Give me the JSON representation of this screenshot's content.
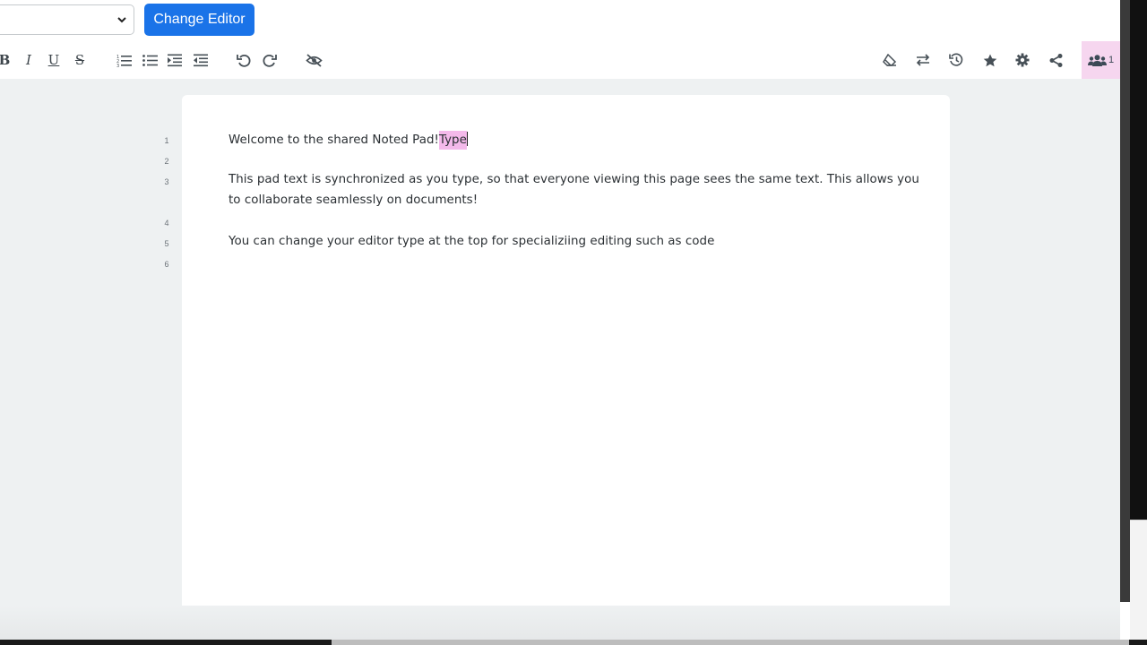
{
  "topbar": {
    "editor_select_value": "",
    "change_editor_label": "Change Editor"
  },
  "toolbar": {
    "left": [
      {
        "name": "bold-button",
        "icon": "bold-icon",
        "text": "B"
      },
      {
        "name": "italic-button",
        "icon": "italic-icon",
        "text": "I"
      },
      {
        "name": "underline-button",
        "icon": "underline-icon",
        "text": "U"
      },
      {
        "name": "strikethrough-button",
        "icon": "strikethrough-icon",
        "text": "S"
      },
      {
        "name": "ordered-list-button",
        "icon": "ordered-list-icon"
      },
      {
        "name": "unordered-list-button",
        "icon": "unordered-list-icon"
      },
      {
        "name": "indent-button",
        "icon": "indent-icon"
      },
      {
        "name": "outdent-button",
        "icon": "outdent-icon"
      },
      {
        "name": "undo-button",
        "icon": "undo-icon"
      },
      {
        "name": "redo-button",
        "icon": "redo-icon"
      },
      {
        "name": "hide-colors-button",
        "icon": "eye-slash-icon"
      }
    ],
    "right": [
      {
        "name": "clear-authorship-button",
        "icon": "eraser-icon"
      },
      {
        "name": "import-export-button",
        "icon": "swap-arrows-icon"
      },
      {
        "name": "timeslider-button",
        "icon": "history-icon"
      },
      {
        "name": "saved-revision-button",
        "icon": "star-icon"
      },
      {
        "name": "settings-button",
        "icon": "gear-icon"
      },
      {
        "name": "share-button",
        "icon": "share-icon"
      }
    ],
    "users": {
      "icon": "users-icon",
      "count": "1"
    }
  },
  "editor": {
    "lines": [
      {
        "number": "1",
        "text": "Welcome to the shared Noted Pad!",
        "highlight": "Type"
      },
      {
        "number": "2",
        "text": ""
      },
      {
        "number": "3",
        "text": "This pad text is synchronized as you type, so that everyone viewing this page sees the same text. This allows you",
        "continuation": "to collaborate seamlessly on documents!"
      },
      {
        "number": "4",
        "text": ""
      },
      {
        "number": "5",
        "text": "You can change your editor type at the top for specializiing editing such as code"
      },
      {
        "number": "6",
        "text": ""
      }
    ]
  },
  "colors": {
    "primary_button": "#1a73e8",
    "author_highlight": "#f4b9ea",
    "users_button_bg": "#f6d6ef",
    "canvas_bg": "#eef1f2"
  }
}
